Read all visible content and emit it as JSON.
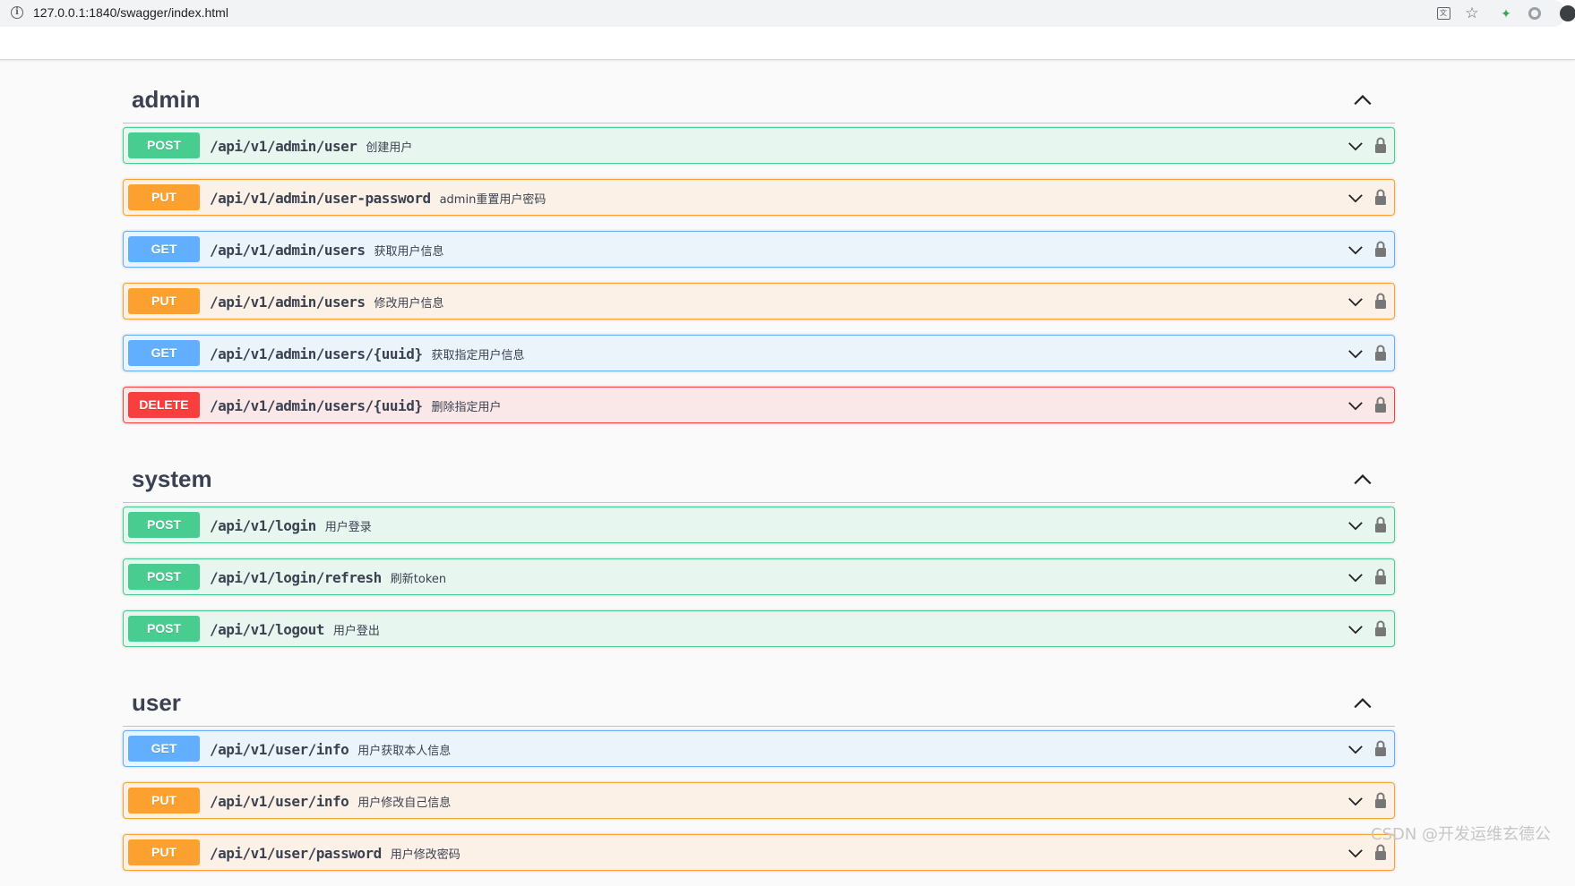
{
  "browser": {
    "url": "127.0.0.1:1840/swagger/index.html",
    "icons": [
      "info-icon",
      "translate-icon",
      "star-icon",
      "extension-icon",
      "circle-icon",
      "profile-icon"
    ]
  },
  "colors": {
    "post": "#49cc90",
    "put": "#fca130",
    "get": "#61affe",
    "delete": "#f93e3e"
  },
  "sections": [
    {
      "name": "admin",
      "operations": [
        {
          "method": "POST",
          "path": "/api/v1/admin/user",
          "summary": "创建用户"
        },
        {
          "method": "PUT",
          "path": "/api/v1/admin/user-password",
          "summary": "admin重置用户密码"
        },
        {
          "method": "GET",
          "path": "/api/v1/admin/users",
          "summary": "获取用户信息"
        },
        {
          "method": "PUT",
          "path": "/api/v1/admin/users",
          "summary": "修改用户信息"
        },
        {
          "method": "GET",
          "path": "/api/v1/admin/users/{uuid}",
          "summary": "获取指定用户信息"
        },
        {
          "method": "DELETE",
          "path": "/api/v1/admin/users/{uuid}",
          "summary": "删除指定用户"
        }
      ]
    },
    {
      "name": "system",
      "operations": [
        {
          "method": "POST",
          "path": "/api/v1/login",
          "summary": "用户登录"
        },
        {
          "method": "POST",
          "path": "/api/v1/login/refresh",
          "summary": "刷新token"
        },
        {
          "method": "POST",
          "path": "/api/v1/logout",
          "summary": "用户登出"
        }
      ]
    },
    {
      "name": "user",
      "operations": [
        {
          "method": "GET",
          "path": "/api/v1/user/info",
          "summary": "用户获取本人信息"
        },
        {
          "method": "PUT",
          "path": "/api/v1/user/info",
          "summary": "用户修改自己信息"
        },
        {
          "method": "PUT",
          "path": "/api/v1/user/password",
          "summary": "用户修改密码"
        }
      ]
    }
  ],
  "watermark": "CSDN @开发运维玄德公"
}
